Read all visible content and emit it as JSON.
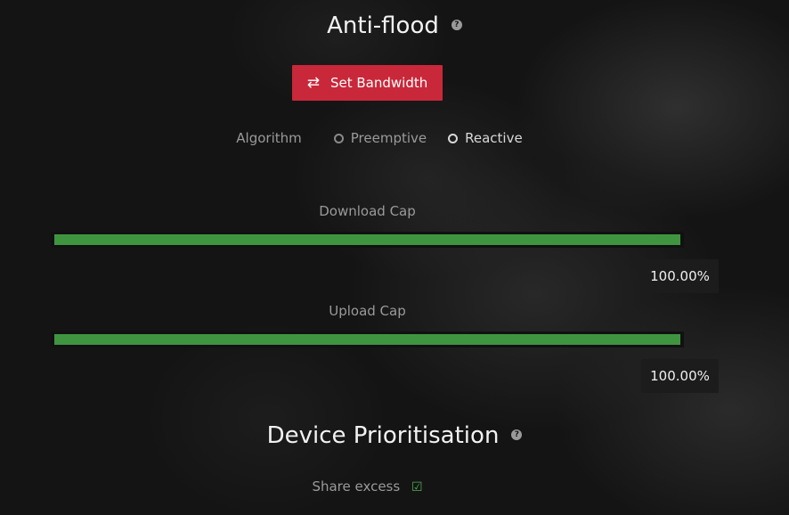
{
  "antiflood": {
    "title": "Anti-flood",
    "help_icon": "question-circle-icon",
    "set_bandwidth_label": "Set Bandwidth",
    "set_bandwidth_icon": "exchange-icon",
    "button_color": "#c9283a"
  },
  "algorithm": {
    "label": "Algorithm",
    "options": [
      {
        "label": "Preemptive",
        "selected": false
      },
      {
        "label": "Reactive",
        "selected": true
      }
    ]
  },
  "download_cap": {
    "label": "Download Cap",
    "value_text": "100.00%",
    "fill_fraction": 1.0,
    "fill_color": "#3f9440"
  },
  "upload_cap": {
    "label": "Upload Cap",
    "value_text": "100.00%",
    "fill_fraction": 1.0,
    "fill_color": "#3f9440"
  },
  "device_prioritisation": {
    "title": "Device Prioritisation",
    "help_icon": "question-circle-icon",
    "share_excess_label": "Share excess",
    "share_excess_checked": true,
    "check_icon": "check-square-icon"
  }
}
